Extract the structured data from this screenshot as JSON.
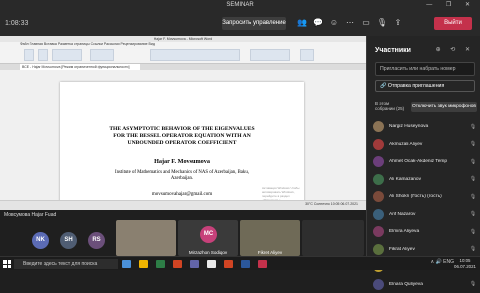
{
  "window": {
    "title": "SEMINAR",
    "controls": "— ❐ ✕"
  },
  "meeting": {
    "timer": "1:08:33",
    "share_button": "Запросить управление",
    "exit_button": "Выйти",
    "toolbar_icons": [
      "people-icon",
      "chat-icon",
      "reaction-icon",
      "more-icon",
      "camera-icon",
      "mic-icon",
      "share-icon"
    ]
  },
  "shared_screen": {
    "word_title": "Hajar F. Movsumova - Microsoft Word",
    "ribbon_tabs": "Файл   Главная   Вставка   Разметка страницы   Ссылки   Рассылки   Рецензирование   Вид",
    "doc_tab": "ВСЕ - Hajar Movsumova [Режим ограниченной функциональности]",
    "paper": {
      "title": [
        "THE ASYMPTOTIC  BEHAVIOR  OF THE EIGENVALUES",
        "FOR THE BESSEL OPERATOR EQUATION WITH AN",
        "UNBOUNDED OPERATOR COEFFICIENT"
      ],
      "author": "Hajar F. Movsumova",
      "affiliation": [
        "Institute of Mathematics and Mechanics of NAS of Azerbaijan, Baku,",
        "Azerbaijan."
      ],
      "email": "movsumovahajar@gmail.com"
    },
    "watermark": "Активация Windows\nЧтобы активировать Windows, перейдите в раздел «Параметры».",
    "tray_text": "30°C  Солнечно    10:05  06.07.2021"
  },
  "presenter_label": "Мовсумова Hajar Fuad",
  "tiles": [
    {
      "initials": "NK",
      "color": "#5b6bb5"
    },
    {
      "initials": "SH",
      "color": "#4f5d73"
    },
    {
      "initials": "RS",
      "color": "#6b4f7a"
    },
    {
      "initials": "MC",
      "label": "Mirzazhon Sodiqov",
      "color": "#c7417a"
    },
    {
      "initials": "",
      "label": "Fikret Aliyev",
      "color": "#6f6a57"
    }
  ],
  "panel": {
    "title": "Участники",
    "icons": "⊕ ⟲ ✕",
    "invite_placeholder": "Пригласить или набрать номер",
    "send_invite": "Отправка приглашения",
    "lobby_label": "В этом собрании (25)",
    "lobby_button": "Отключить звук микрофонов",
    "participants": [
      {
        "name": "Nargiz Huseynova",
        "color": "#8b7355"
      },
      {
        "name": "Akmuzali Aliyev",
        "color": "#a03a3a"
      },
      {
        "name": "Ahmet Ocak-Akdeniz Temp",
        "color": "#6b3e7a"
      },
      {
        "name": "Ali Kamazanov",
        "color": "#3d6e4a"
      },
      {
        "name": "Ali Shokri (Гость) (гость)",
        "color": "#7a4a3a"
      },
      {
        "name": "Arif Nazarov",
        "color": "#3a5f7a"
      },
      {
        "name": "Elmira Aliyeva",
        "color": "#7a3a5f"
      },
      {
        "name": "Fikrat Aliyev",
        "color": "#5a6f3d"
      },
      {
        "name": "Fer (гость)",
        "color": "#c0a030"
      },
      {
        "name": "Elnara Quliyeva",
        "color": "#4a4a7a"
      }
    ]
  },
  "taskbar": {
    "search_placeholder": "Введите здесь текст для поиска",
    "apps": [
      "#4a90d9",
      "#f0b400",
      "#2d7d46",
      "#d04423",
      "#6264a7",
      "#e8e8e8",
      "#d04423",
      "#2b579a",
      "#c4314b"
    ],
    "tray": "∧ 🔊 ENG",
    "time": "10:05",
    "date": "06.07.2021"
  }
}
